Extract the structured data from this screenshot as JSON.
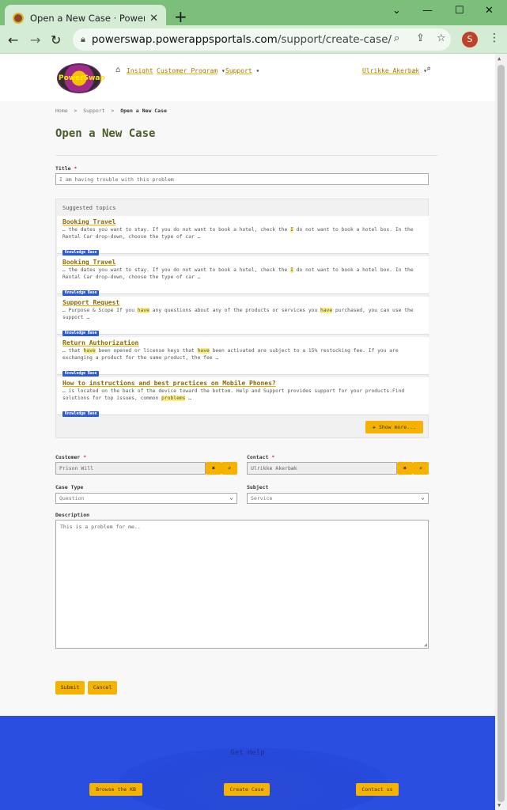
{
  "browser": {
    "tab_title": "Open a New Case · PowerSwap c",
    "tab_close": "✕",
    "new_tab": "+",
    "url_host": "powerswap.powerappsportals.com",
    "url_path": "/support/create-case/",
    "profile_initial": "S"
  },
  "header": {
    "logo_text": "PowerSwap",
    "nav": {
      "insight": "Insight",
      "customer_program": "Customer Program",
      "support": "Support",
      "user": "Ulrikke Akerbæk"
    }
  },
  "breadcrumb": {
    "home": "Home",
    "support": "Support",
    "current": "Open a New Case"
  },
  "page_title": "Open a New Case",
  "form": {
    "title_label": "Title",
    "title_value": "I am having trouble with this problem",
    "customer_label": "Customer",
    "customer_value": "Prison Will",
    "contact_label": "Contact",
    "contact_value": "Ulrikke Akerbæk",
    "case_type_label": "Case Type",
    "case_type_value": "Question",
    "subject_label": "Subject",
    "subject_value": "Service",
    "description_label": "Description",
    "description_value": "This is a problem for me..",
    "submit": "Submit",
    "cancel": "Cancel"
  },
  "suggestions": {
    "heading": "Suggested topics",
    "badge": "Knowledge Base",
    "show_more": "Show more...",
    "items": [
      {
        "title": "Booking Travel",
        "pre": "… the dates you want to stay. If you do not want to book a hotel, check the ",
        "hl1": "I",
        "mid": " do not want to book a hotel box. In the Rental Car drop-down, choose the type of car …",
        "hl2": "",
        "post": ""
      },
      {
        "title": "Booking Travel",
        "pre": "… the dates you want to stay. If you do not want to book a hotel, check the ",
        "hl1": "I",
        "mid": " do not want to book a hotel box. In the Rental Car drop-down, choose the type of car …",
        "hl2": "",
        "post": ""
      },
      {
        "title": "Support Request",
        "pre": "… Purpose & Scope If you ",
        "hl1": "have",
        "mid": " any questions about any of the products or services you ",
        "hl2": "have",
        "post": " purchased, you can use the support …"
      },
      {
        "title": "Return Authorization",
        "pre": "… that ",
        "hl1": "have",
        "mid": " been opened or license keys that ",
        "hl2": "have",
        "post": " been activated are subject to a 15% restocking fee. If you are exchanging a product for the same product, the fee …"
      },
      {
        "title": "How to instructions and best practices on Mobile Phones?",
        "pre": "… is located on the back of the device toward the bottom.   Help and Support provides support for your products.Find solutions for top issues, common ",
        "hl1": "problems",
        "mid": " …",
        "hl2": "",
        "post": ""
      }
    ]
  },
  "footer": {
    "title": "Get Help",
    "browse": "Browse the KB",
    "create": "Create Case",
    "contact": "Contact us"
  }
}
